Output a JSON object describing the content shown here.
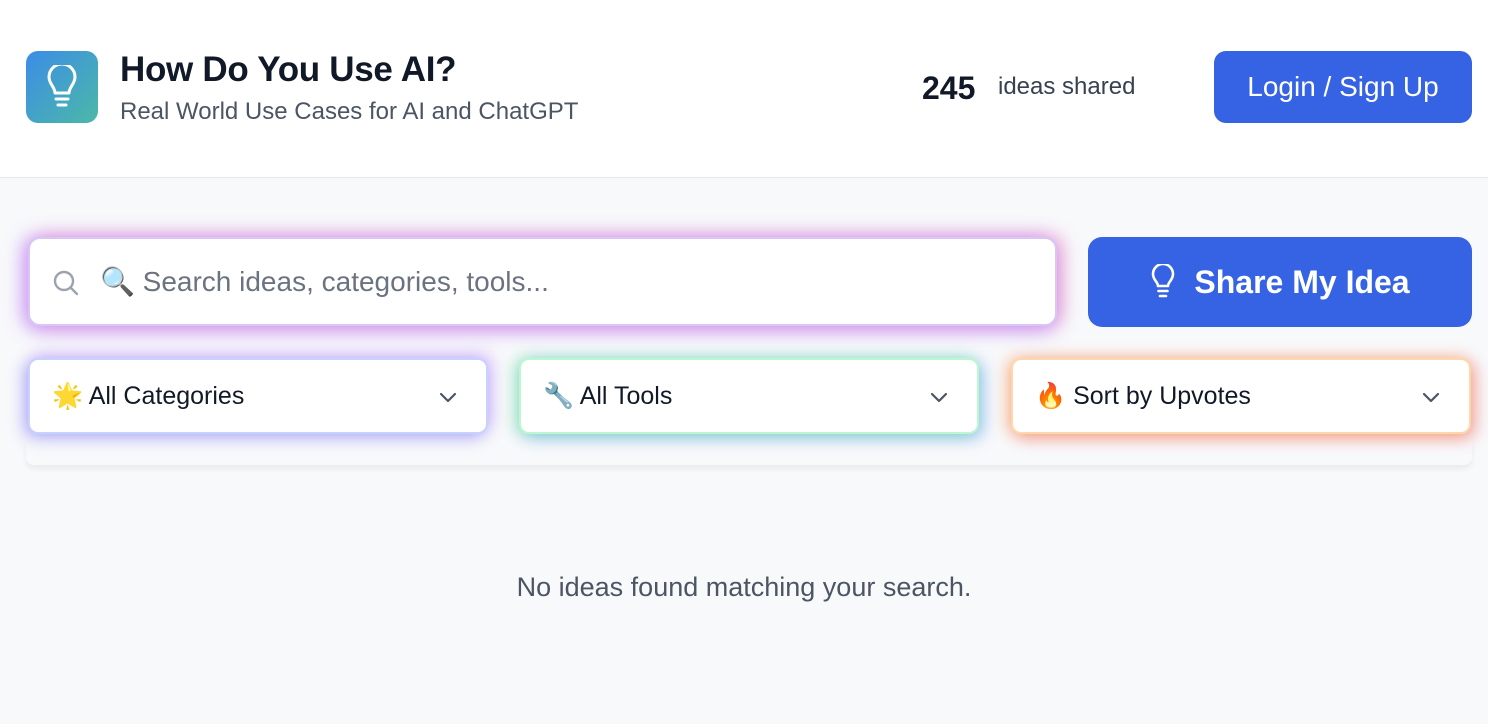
{
  "header": {
    "logo_icon": "lightbulb-icon",
    "title": "How Do You Use AI?",
    "subtitle": "Real World Use Cases for AI and ChatGPT",
    "ideas_count": "245",
    "ideas_label": "ideas shared",
    "login_label": "Login / Sign Up"
  },
  "search": {
    "icon": "search-icon",
    "placeholder": "🔍 Search ideas, categories, tools...",
    "value": ""
  },
  "share_button": {
    "icon": "lightbulb-icon",
    "label": "Share My Idea"
  },
  "filters": {
    "category": {
      "selected": "🌟 All Categories"
    },
    "tools": {
      "selected": "🔧 All Tools"
    },
    "sort": {
      "selected": "🔥 Sort by Upvotes"
    }
  },
  "empty_message": "No ideas found matching your search.",
  "colors": {
    "primary": "#3563e3",
    "logo_gradient_start": "#3b8de6",
    "logo_gradient_end": "#4cb8a8",
    "background": "#f8f9fb"
  }
}
